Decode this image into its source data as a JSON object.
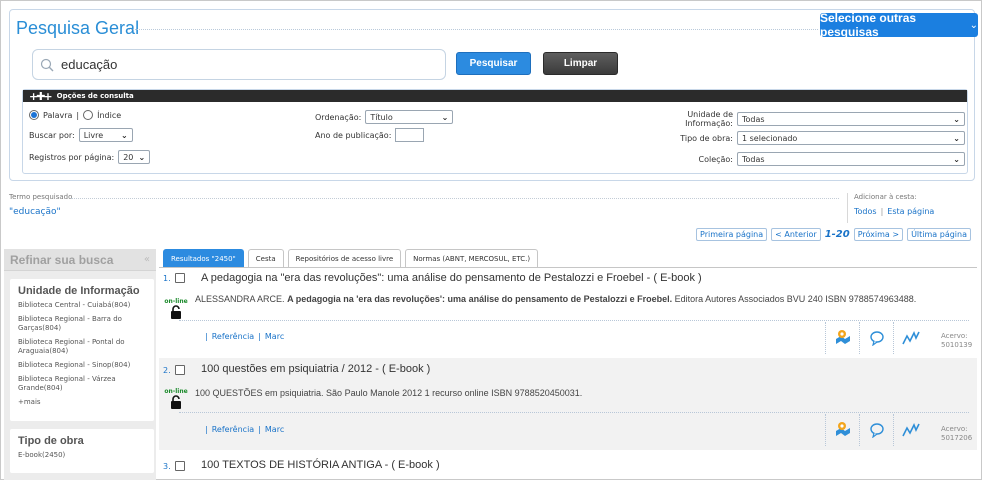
{
  "header": {
    "title": "Pesquisa Geral",
    "other_searches_label": "Selecione outras pesquisas"
  },
  "search": {
    "value": "educação",
    "search_button": "Pesquisar",
    "clear_button": "Limpar"
  },
  "options": {
    "bar_label": "Opções de consulta",
    "mode_palavra": "Palavra",
    "mode_separator": "|",
    "mode_indice": "Índice",
    "mode_selected": "Palavra",
    "buscar_por_label": "Buscar por:",
    "buscar_por_value": "Livre",
    "registros_label": "Registros por página:",
    "registros_value": "20",
    "ordenacao_label": "Ordenação:",
    "ordenacao_value": "Título",
    "ano_label": "Ano de publicação:",
    "ano_value": "",
    "unidade_label": "Unidade de Informação:",
    "unidade_value": "Todas",
    "tipo_obra_label": "Tipo de obra:",
    "tipo_obra_value": "1 selecionado",
    "colecao_label": "Coleção:",
    "colecao_value": "Todas"
  },
  "term": {
    "label": "Termo pesquisado",
    "value": "\"educação\""
  },
  "cart": {
    "label": "Adicionar à cesta:",
    "todos": "Todos",
    "separator": "|",
    "esta_pagina": "Esta página"
  },
  "pager": {
    "first": "Primeira página",
    "prev": "< Anterior",
    "range": "1-20",
    "next": "Próxima >",
    "last": "Última página"
  },
  "refine": {
    "title": "Refinar sua busca",
    "collapse_icon": "«",
    "facets": [
      {
        "title": "Unidade de Informação",
        "items": [
          "Biblioteca Central - Cuiabá(804)",
          "Biblioteca Regional - Barra do Garças(804)",
          "Biblioteca Regional - Pontal do Araguaia(804)",
          "Biblioteca Regional - Sinop(804)",
          "Biblioteca Regional - Várzea Grande(804)"
        ],
        "more": "+mais"
      },
      {
        "title": "Tipo de obra",
        "items": [
          "E-book(2450)"
        ]
      }
    ]
  },
  "tabs": [
    {
      "label": "Resultados \"2450\"",
      "active": true
    },
    {
      "label": "Cesta",
      "active": false
    },
    {
      "label": "Repositórios de acesso livre",
      "active": false
    },
    {
      "label": "Normas (ABNT, MERCOSUL, ETC.)",
      "active": false
    }
  ],
  "results": [
    {
      "num": "1.",
      "title": "A pedagogia na \"era das revoluções\": uma análise do pensamento de Pestalozzi e Froebel - ( E-book )",
      "desc_author": "ALESSANDRA ARCE.",
      "desc_bold": "A pedagogia na 'era das revoluções': uma análise do pensamento de Pestalozzi e Froebel.",
      "desc_rest": "Editora Autores Associados BVU 240 ISBN 9788574963488.",
      "online_label": "on-line",
      "link_ref": "Referência",
      "link_sep": "|",
      "link_marc": "Marc",
      "acervo_label": "Acervo:",
      "acervo_value": "5010139"
    },
    {
      "num": "2.",
      "title": "100 questões em psiquiatria / 2012 - ( E-book )",
      "desc_author": "",
      "desc_bold": "",
      "desc_rest": "100 QUESTÕES em psiquiatria. São Paulo Manole 2012 1 recurso online ISBN 9788520450031.",
      "online_label": "on-line",
      "link_ref": "Referência",
      "link_sep": "|",
      "link_marc": "Marc",
      "acervo_label": "Acervo:",
      "acervo_value": "5017206"
    },
    {
      "num": "3.",
      "title": "100 TEXTOS DE HISTÓRIA ANTIGA - ( E-book )"
    }
  ],
  "icons": {
    "search": "magnifier-icon",
    "online": "unlock-icon",
    "map": "map-pin-icon",
    "comment": "speech-bubble-icon",
    "stats": "trend-line-icon"
  },
  "colors": {
    "accent": "#2c8be0",
    "brand_button": "#1b7fe0",
    "link": "#1a73c8",
    "title": "#2a8ed6"
  }
}
